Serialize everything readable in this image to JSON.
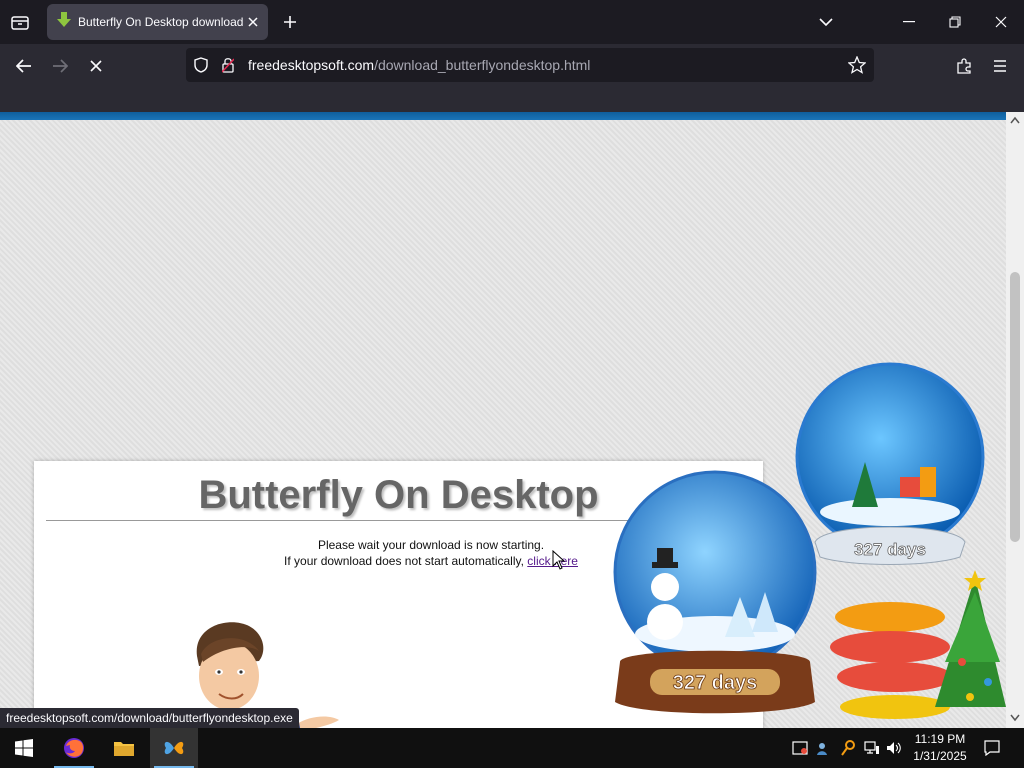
{
  "browser": {
    "tab_title": "Butterfly On Desktop download",
    "url_domain": "freedesktopsoft.com",
    "url_path": "/download_butterflyondesktop.html"
  },
  "page": {
    "heading": "Butterfly On Desktop",
    "message_line1": "Please wait your download is now starting.",
    "message_line2": "If your download does not start automatically, ",
    "click_here": "click here",
    "globe_small_label": "327 days",
    "globe_large_label": "327 days"
  },
  "status_bar": {
    "link_url": "freedesktopsoft.com/download/butterflyondesktop.exe"
  },
  "taskbar": {
    "time": "11:19 PM",
    "date": "1/31/2025"
  },
  "colors": {
    "accent_bar": "#1a74b8",
    "page_background": "#e2e2e2"
  }
}
